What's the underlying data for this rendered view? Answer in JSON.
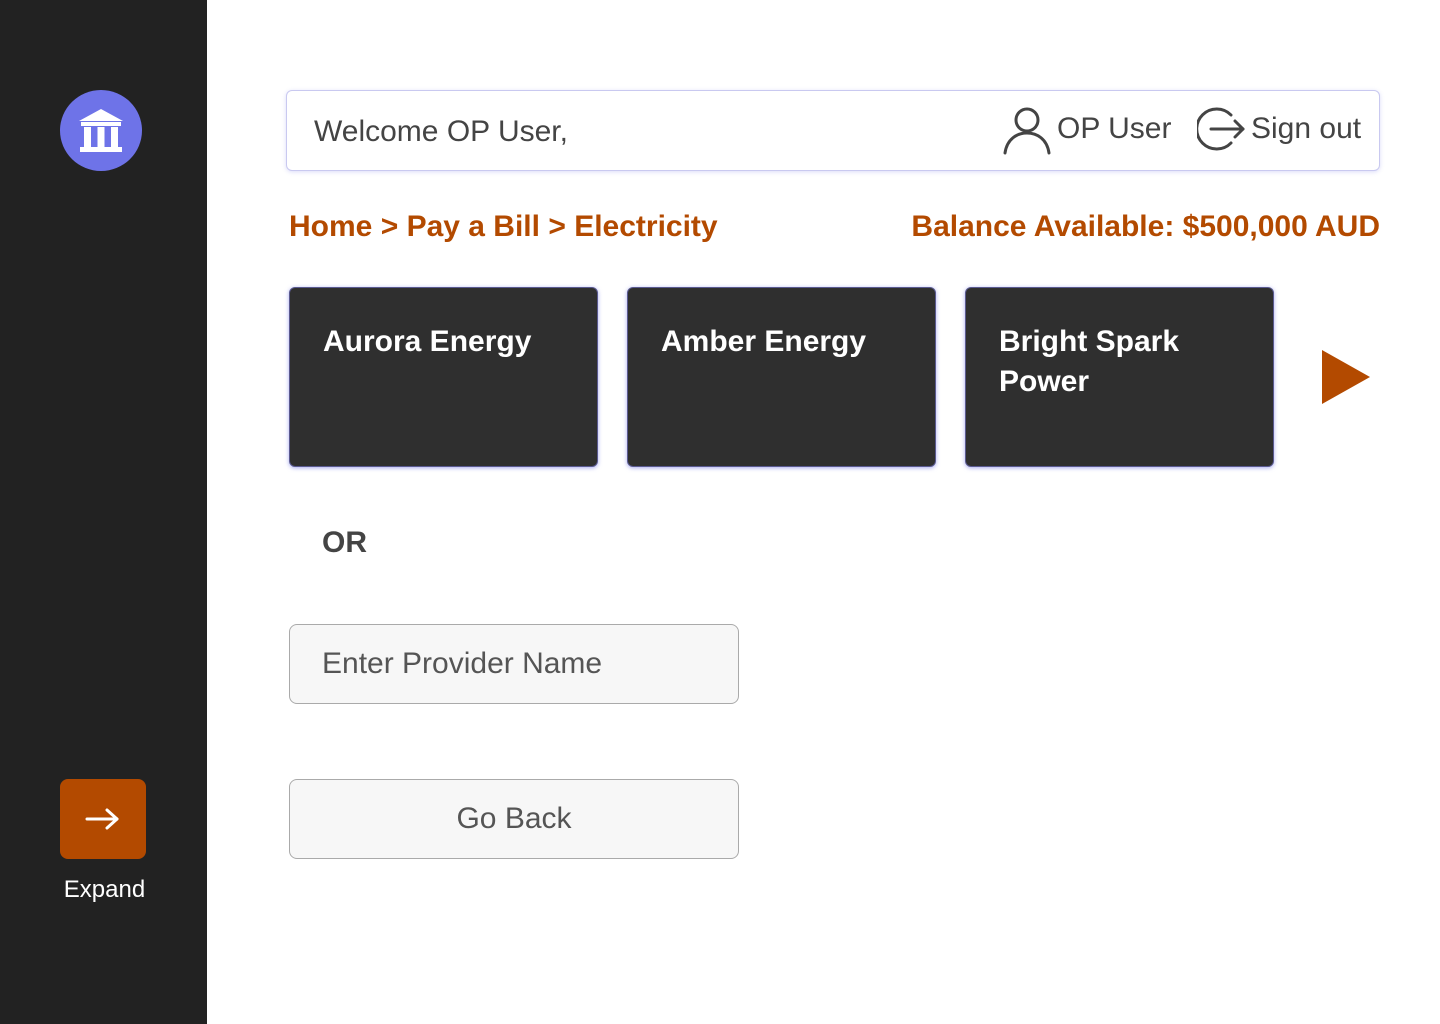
{
  "header": {
    "welcome": "Welcome OP User,",
    "user_name": "OP User",
    "sign_out_label": "Sign out"
  },
  "breadcrumb": {
    "items": [
      "Home",
      "Pay a Bill",
      "Electricity"
    ],
    "separator": ">"
  },
  "balance": "Balance Available: $500,000 AUD",
  "providers": [
    {
      "name": "Aurora Energy"
    },
    {
      "name": "Amber Energy"
    },
    {
      "name": "Bright Spark Power"
    }
  ],
  "or_label": "OR",
  "provider_input": {
    "placeholder": "Enter Provider Name",
    "value": ""
  },
  "go_back_label": "Go Back",
  "sidebar": {
    "expand_label": "Expand"
  },
  "colors": {
    "accent": "#b34a00",
    "sidebar_bg": "#222222",
    "logo_bg": "#6e73e8",
    "card_bg": "#2f2f2f"
  },
  "icons": {
    "logo": "bank-icon",
    "user": "user-icon",
    "sign_out": "sign-out-icon",
    "next": "next-arrow-icon",
    "expand": "arrow-right-icon"
  }
}
